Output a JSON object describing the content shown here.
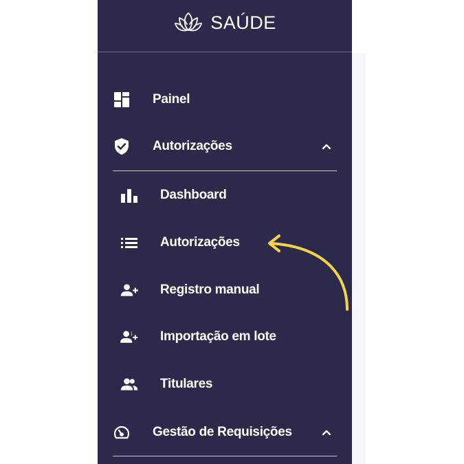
{
  "brand": {
    "name": "SAÚDE",
    "icon": "lotus-icon"
  },
  "menu": {
    "painel": {
      "label": "Painel",
      "icon": "dashboard-grid-icon"
    },
    "autorizacoes": {
      "label": "Autorizações",
      "icon": "shield-check-icon",
      "expanded": true,
      "chevron": "chevron-up-icon"
    },
    "submenu": [
      {
        "label": "Dashboard",
        "icon": "bar-chart-icon"
      },
      {
        "label": "Autorizações",
        "icon": "list-icon"
      },
      {
        "label": "Registro manual",
        "icon": "person-add-icon"
      },
      {
        "label": "Importação em lote",
        "icon": "people-add-icon"
      },
      {
        "label": "Titulares",
        "icon": "people-icon"
      }
    ],
    "gestao": {
      "label": "Gestão de Requisições",
      "icon": "speedometer-icon",
      "chevron": "chevron-up-icon"
    }
  },
  "annotation": {
    "icon": "curved-arrow-icon",
    "color": "#f5d24a"
  },
  "colors": {
    "sidebar_bg": "#2c2a4a",
    "text": "#ffffff",
    "divider": "#c9c8d6"
  }
}
